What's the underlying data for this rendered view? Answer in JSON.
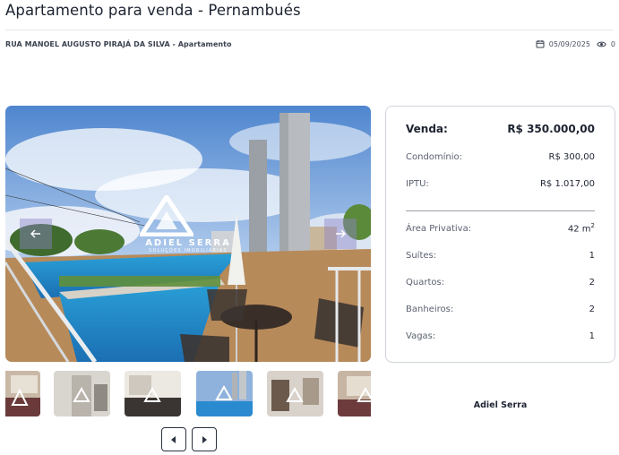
{
  "listing": {
    "title": "Apartamento para venda - Pernambués",
    "address": "RUA MANOEL AUGUSTO PIRAJÁ DA SILVA - Apartamento",
    "date": "05/09/2025",
    "views": "0"
  },
  "icons": {
    "calendar": "calendar-icon",
    "views": "eye-icon",
    "prev": "chevron-left-icon",
    "next": "chevron-right-icon"
  },
  "gallery": {
    "watermark_name": "ADIEL SERRA",
    "watermark_tag": "SOLUÇÕES IMOBILIÁRIAS",
    "thumbnails": [
      "thumb-1",
      "thumb-2",
      "thumb-3",
      "thumb-4",
      "thumb-5",
      "thumb-6"
    ]
  },
  "pricing": {
    "sale_label": "Venda:",
    "sale_value": "R$ 350.000,00",
    "condo_label": "Condomínio:",
    "condo_value": "R$ 300,00",
    "iptu_label": "IPTU:",
    "iptu_value": "R$ 1.017,00"
  },
  "features": {
    "area_label": "Área Privativa:",
    "area_value": "42 m",
    "area_unit_sup": "2",
    "suites_label": "Suítes:",
    "suites_value": "1",
    "bedrooms_label": "Quartos:",
    "bedrooms_value": "2",
    "bathrooms_label": "Banheiros:",
    "bathrooms_value": "2",
    "parking_label": "Vagas:",
    "parking_value": "1"
  },
  "agent": {
    "name": "Adiel Serra"
  },
  "colors": {
    "text": "#1d2330",
    "border": "#cfd4da",
    "pool": "#2f7ec4",
    "sky": "#5b8fd1"
  }
}
